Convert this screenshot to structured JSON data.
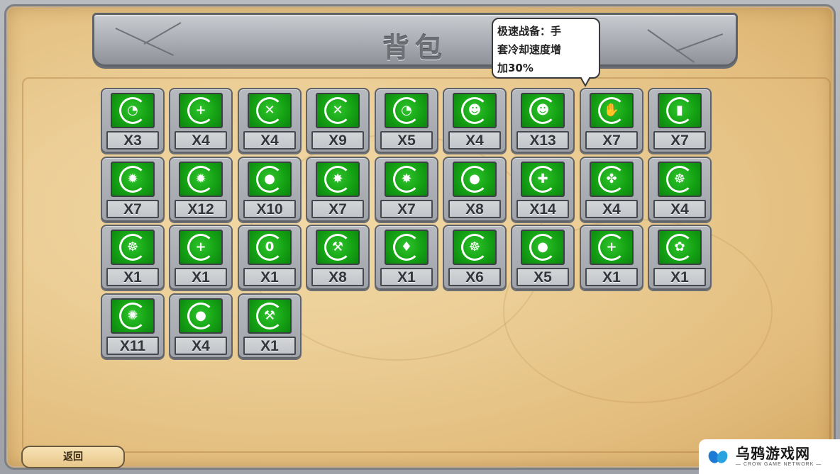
{
  "header": {
    "title": "背包"
  },
  "tooltip": {
    "line1": "极速战备：手",
    "line2": "套冷却速度增",
    "line3": "加30%"
  },
  "inventory": {
    "rows": [
      [
        {
          "icon": "seed-launcher-icon",
          "glyph": "◔",
          "count": "X3"
        },
        {
          "icon": "seed-plus-icon",
          "glyph": "+",
          "count": "X4"
        },
        {
          "icon": "crosshair-cancel-icon",
          "glyph": "✕",
          "count": "X4"
        },
        {
          "icon": "no-target-icon",
          "glyph": "✕",
          "count": "X9"
        },
        {
          "icon": "seed-launcher-cooldown-icon",
          "glyph": "◔",
          "count": "X5"
        },
        {
          "icon": "zombie-head-icon",
          "glyph": "☻",
          "count": "X4"
        },
        {
          "icon": "zombie-brain-icon",
          "glyph": "☻",
          "count": "X13"
        },
        {
          "icon": "glove-minus-icon",
          "glyph": "✋",
          "count": "X7"
        },
        {
          "icon": "cards-icon",
          "glyph": "▮",
          "count": "X7"
        }
      ],
      [
        {
          "icon": "sun-minus-icon",
          "glyph": "✹",
          "count": "X7"
        },
        {
          "icon": "sun-plus-icon",
          "glyph": "✹",
          "count": "X12"
        },
        {
          "icon": "bomb-plus-icon",
          "glyph": "●",
          "count": "X10"
        },
        {
          "icon": "spiky-plus-icon",
          "glyph": "✸",
          "count": "X7"
        },
        {
          "icon": "cactus-plus-icon",
          "glyph": "✸",
          "count": "X7"
        },
        {
          "icon": "apple-plus-icon",
          "glyph": "●",
          "count": "X8"
        },
        {
          "icon": "heart-plus-icon",
          "glyph": "✚",
          "count": "X14"
        },
        {
          "icon": "fan-icon",
          "glyph": "✤",
          "count": "X4"
        },
        {
          "icon": "chomper-icon",
          "glyph": "☸",
          "count": "X4"
        }
      ],
      [
        {
          "icon": "chomper-ring-icon",
          "glyph": "☸",
          "count": "X1"
        },
        {
          "icon": "refresh-plus-icon",
          "glyph": "+",
          "count": "X1"
        },
        {
          "icon": "zero-icon",
          "glyph": "0",
          "count": "X1"
        },
        {
          "icon": "hammer-minus-icon",
          "glyph": "⚒",
          "count": "X8"
        },
        {
          "icon": "drop-icon",
          "glyph": "♦",
          "count": "X1"
        },
        {
          "icon": "mouth-icon",
          "glyph": "☸",
          "count": "X6"
        },
        {
          "icon": "pea-pod-icon",
          "glyph": "●",
          "count": "X5"
        },
        {
          "icon": "stem-plus-icon",
          "glyph": "+",
          "count": "X1"
        },
        {
          "icon": "flower-ring-icon",
          "glyph": "✿",
          "count": "X1"
        }
      ],
      [
        {
          "icon": "gear-sun-icon",
          "glyph": "✺",
          "count": "X11"
        },
        {
          "icon": "apple-double-plus-icon",
          "glyph": "●",
          "count": "X4"
        },
        {
          "icon": "tools-icon",
          "glyph": "⚒",
          "count": "X1"
        }
      ]
    ]
  },
  "footer": {
    "back_label": "返回"
  },
  "watermark": {
    "name": "乌鸦游戏网",
    "sub": "— CROW GAME NETWORK —"
  }
}
